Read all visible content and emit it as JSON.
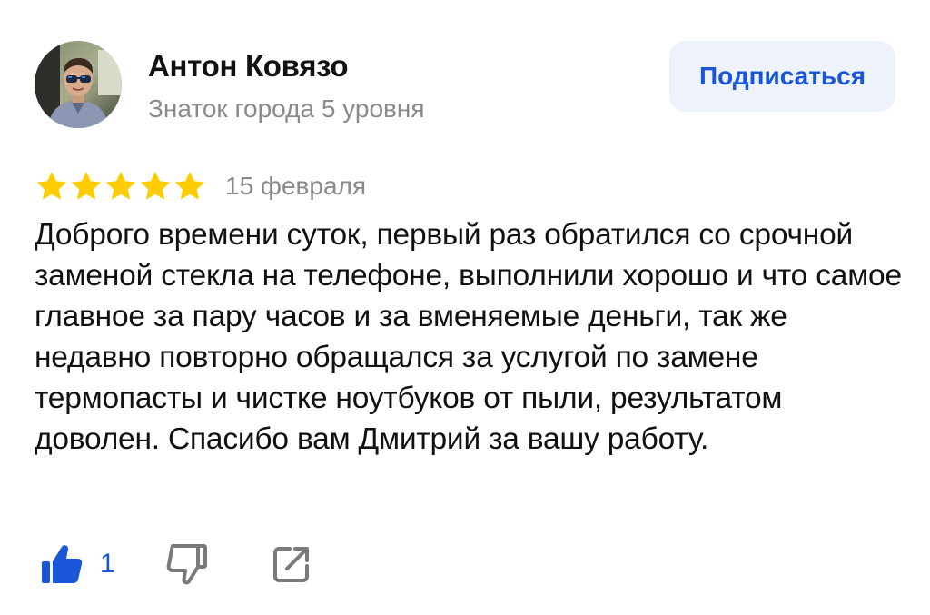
{
  "author": {
    "name": "Антон Ковязо",
    "level": "Знаток города 5 уровня"
  },
  "subscribe": {
    "label": "Подписаться"
  },
  "review": {
    "rating": 5,
    "rating_max": 5,
    "date": "15 февраля",
    "text": "Доброго времени суток, первый раз обратился со срочной заменой стекла на телефоне, выполнили хорошо и что самое главное за пару часов и за вменяемые деньги, так же недавно повторно обращался за услугой по замене термопасты и чистке ноутбуков от пыли, результатом доволен. Спасибо вам Дмитрий за вашу работу."
  },
  "actions": {
    "like_icon": "thumbs-up-icon",
    "like_count": "1",
    "dislike_icon": "thumbs-down-icon",
    "share_icon": "share-icon"
  },
  "colors": {
    "accent": "#1a56d8",
    "star": "#ffcc00",
    "secondary_text": "#8a8a8e",
    "button_bg": "#eef3fb",
    "icon_gray": "#7a7a7e"
  }
}
